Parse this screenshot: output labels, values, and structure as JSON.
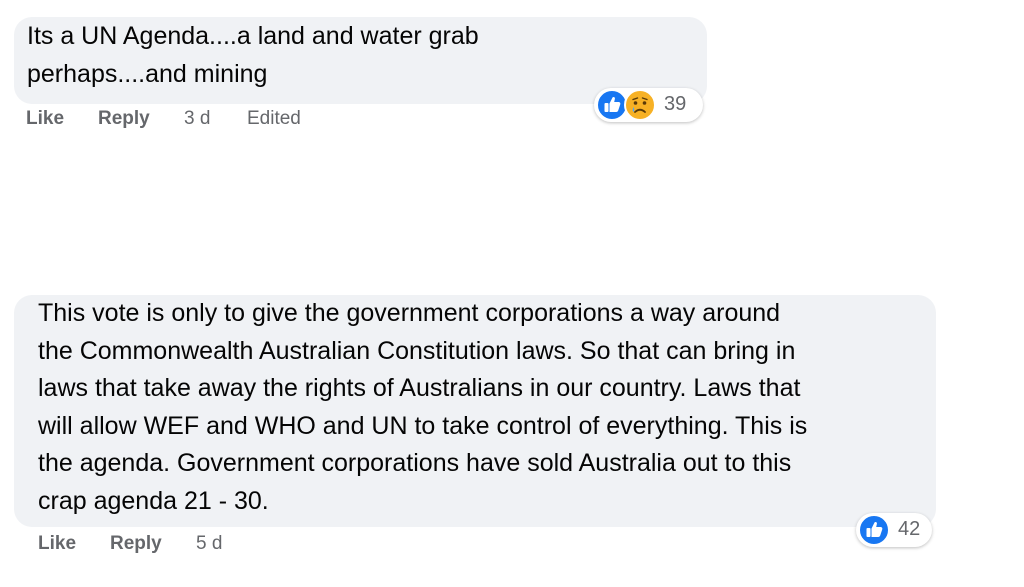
{
  "comments": [
    {
      "lines": [
        "Its a UN Agenda....a land and water grab",
        "perhaps....and mining"
      ],
      "actions": {
        "like": "Like",
        "reply": "Reply",
        "time": "3 d",
        "edited": "Edited"
      },
      "reactions": {
        "icons": [
          "like-icon",
          "sad-icon"
        ],
        "count": "39"
      }
    },
    {
      "lines": [
        "This vote is only to give the government corporations a way around",
        "the Commonwealth Australian Constitution laws. So that can bring in",
        "laws that take away the rights of Australians in our country. Laws that",
        "will allow WEF and WHO and UN to take control of everything. This is",
        "the agenda. Government corporations have sold Australia out to this",
        "crap agenda 21 - 30."
      ],
      "actions": {
        "like": "Like",
        "reply": "Reply",
        "time": "5 d"
      },
      "reactions": {
        "icons": [
          "like-icon"
        ],
        "count": "42"
      }
    }
  ],
  "colors": {
    "bubble": "#f0f2f5",
    "secondary_text": "#65676b",
    "like_blue": "#1877f2",
    "sad_yellow": "#f7b125"
  }
}
